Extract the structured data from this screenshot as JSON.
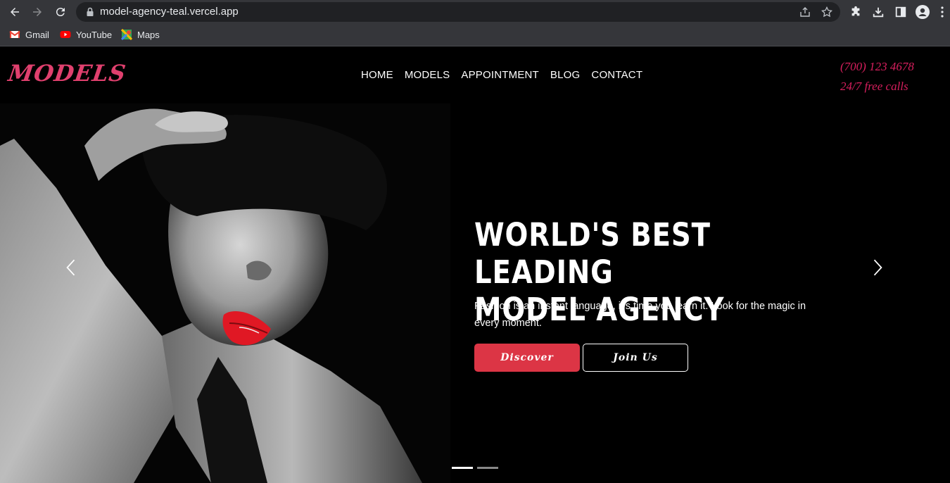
{
  "browser": {
    "url": "model-agency-teal.vercel.app",
    "bookmarks": [
      {
        "label": "Gmail",
        "icon": "gmail-icon"
      },
      {
        "label": "YouTube",
        "icon": "youtube-icon"
      },
      {
        "label": "Maps",
        "icon": "maps-icon"
      }
    ]
  },
  "header": {
    "logo": "MODELS",
    "nav": [
      "HOME",
      "MODELS",
      "APPOINTMENT",
      "BLOG",
      "CONTACT"
    ],
    "phone": "(700) 123 4678",
    "phone_note": "24/7 free calls"
  },
  "hero": {
    "title_line1": "WORLD'S BEST LEADING",
    "title_line2": "MODEL AGENCY",
    "subtitle": "Fashion is an instant language, it's time you learn it. Look for the magic in every moment.",
    "primary_button": "Discover",
    "secondary_button": "Join Us",
    "slides_total": 2,
    "active_slide": 1
  },
  "colors": {
    "accent": "#dc3545",
    "logo": "#e0406e",
    "phone": "#d81f5e",
    "background": "#000000"
  }
}
